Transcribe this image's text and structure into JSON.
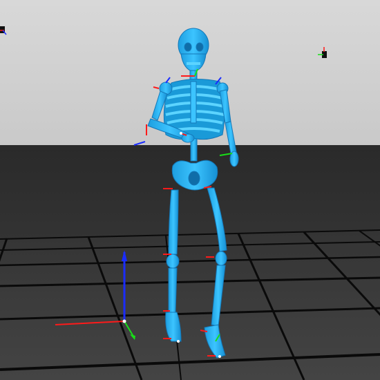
{
  "viewport": {
    "background_sky": "#d2d2d2",
    "background_wall": "#2b2b2b",
    "floor_tile": "#3a3a3a",
    "floor_line": "#050505",
    "skeleton_color": "#2ab4f2",
    "axis_x_color": "#ff1a1a",
    "axis_y_color": "#18e018",
    "axis_z_color": "#1a2cff"
  },
  "icons": {
    "camera": "camera-light-icon",
    "world_axes": "world-origin-gizmo-icon",
    "joint_axes": "joint-axes-gizmo-icon"
  }
}
